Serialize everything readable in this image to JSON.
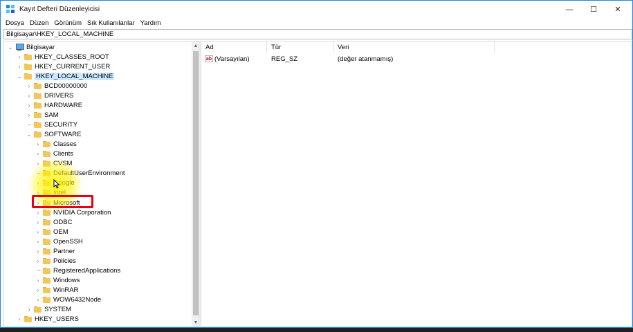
{
  "window": {
    "title": "Kayıt Defteri Düzenleyicisi",
    "controls": {
      "minimize": "—",
      "maximize": "☐",
      "close": "✕"
    }
  },
  "menu": {
    "items": [
      "Dosya",
      "Düzen",
      "Görünüm",
      "Sık Kullanılanlar",
      "Yardım"
    ]
  },
  "address": {
    "path": "Bilgisayar\\HKEY_LOCAL_MACHINE"
  },
  "tree": {
    "root": "Bilgisayar",
    "hives": {
      "classes_root": "HKEY_CLASSES_ROOT",
      "current_user": "HKEY_CURRENT_USER",
      "local_machine": "HKEY_LOCAL_MACHINE",
      "users": "HKEY_USERS"
    },
    "hklm_children": [
      "BCD00000000",
      "DRIVERS",
      "HARDWARE",
      "SAM",
      "SECURITY",
      "SOFTWARE",
      "SYSTEM"
    ],
    "software_children": [
      "Classes",
      "Clients",
      "CVSM",
      "DefaultUserEnvironment",
      "Google",
      "Intel",
      "Microsoft",
      "NVIDIA Corporation",
      "ODBC",
      "OEM",
      "OpenSSH",
      "Partner",
      "Policies",
      "RegisteredApplications",
      "Windows",
      "WinRAR",
      "WOW6432Node"
    ]
  },
  "list": {
    "headers": {
      "name": "Ad",
      "type": "Tür",
      "data": "Veri"
    },
    "rows": [
      {
        "name": "(Varsayılan)",
        "type": "REG_SZ",
        "data": "(değer atanmamış)",
        "icon": "ab"
      }
    ]
  },
  "colors": {
    "accent": "#1e88e5",
    "selection": "#cce8ff",
    "folder": "#f3c65a",
    "annotation_box": "#e60012",
    "highlight": "#fff500"
  }
}
